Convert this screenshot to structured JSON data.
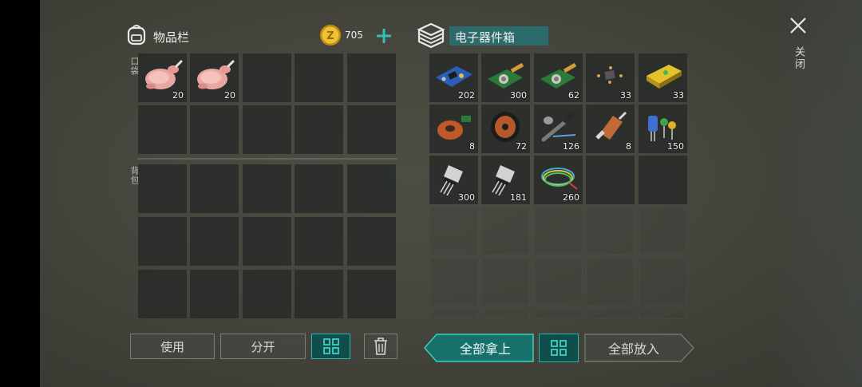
{
  "inventory": {
    "title": "物品栏",
    "coins": "705",
    "pocket_label": "口袋",
    "backpack_label": "背包",
    "pocket_items": [
      {
        "icon": "roast-chicken",
        "count": "20"
      },
      {
        "icon": "roast-chicken",
        "count": "20"
      }
    ]
  },
  "container": {
    "title": "电子器件箱",
    "items": [
      {
        "icon": "circuit-board",
        "count": "202"
      },
      {
        "icon": "sensor-module",
        "count": "300"
      },
      {
        "icon": "sensor-module",
        "count": "62"
      },
      {
        "icon": "processor-board",
        "count": "33"
      },
      {
        "icon": "battery",
        "count": "33"
      },
      {
        "icon": "inductor-coil",
        "count": "8"
      },
      {
        "icon": "copper-wire-spool",
        "count": "72"
      },
      {
        "icon": "soldering-iron",
        "count": "126"
      },
      {
        "icon": "electric-motor",
        "count": "8"
      },
      {
        "icon": "capacitors",
        "count": "150"
      },
      {
        "icon": "transistor",
        "count": "300"
      },
      {
        "icon": "transistor",
        "count": "181"
      },
      {
        "icon": "wire-bundle",
        "count": "260"
      }
    ]
  },
  "buttons": {
    "use": "使用",
    "split": "分开",
    "take_all": "全部拿上",
    "put_all": "全部放入"
  },
  "close_label": "关闭",
  "colors": {
    "accent": "#2fb5a7",
    "accent_dark": "#0f4e4b",
    "coin": "#e8b422"
  }
}
